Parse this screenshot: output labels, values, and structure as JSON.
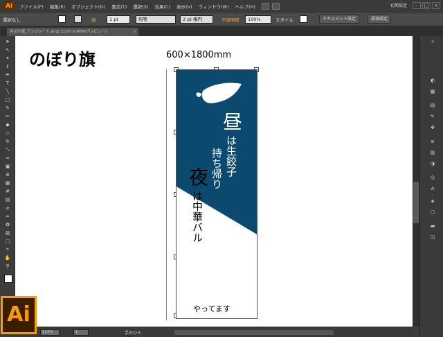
{
  "app": {
    "logo": "Ai",
    "workspace": "初期設定"
  },
  "menu": [
    "ファイル(F)",
    "編集(E)",
    "オブジェクト(O)",
    "書式(T)",
    "選択(S)",
    "効果(C)",
    "表示(V)",
    "ウィンドウ(W)",
    "ヘルプ(H)"
  ],
  "window_controls": {
    "minimize": "–",
    "maximize": "□",
    "close": "×"
  },
  "control_bar": {
    "selection": "選択なし",
    "stroke_label": "線",
    "stroke_weight": "1 pt",
    "line_style": "均等",
    "brush": "2 pt 楕円",
    "opacity_label": "不透明度",
    "opacity": "100%",
    "style_label": "スタイル",
    "doc_settings": "ドキュメント設定",
    "preferences": "環境設定"
  },
  "document_tab": {
    "name": "のぼり旗_テンプレート.ai @ 113% (CMYK/プレビュー)",
    "close": "×"
  },
  "canvas": {
    "title": "のぼり旗",
    "size": "600×1800mm"
  },
  "banner": {
    "text_hiru": "昼",
    "text_hiru_sub": "は生餃子",
    "text_takeout": "持ち帰り",
    "text_yoru": "夜",
    "text_yoru_sub": "は中華バル",
    "text_open": "やってます",
    "colors": {
      "navy": "#0b4a6e",
      "white": "#ffffff"
    }
  },
  "status": {
    "zoom": "113%",
    "page": "1",
    "tool": "手のひら"
  },
  "brand": {
    "logo_text": "Ai",
    "color": "#ff9a00"
  }
}
